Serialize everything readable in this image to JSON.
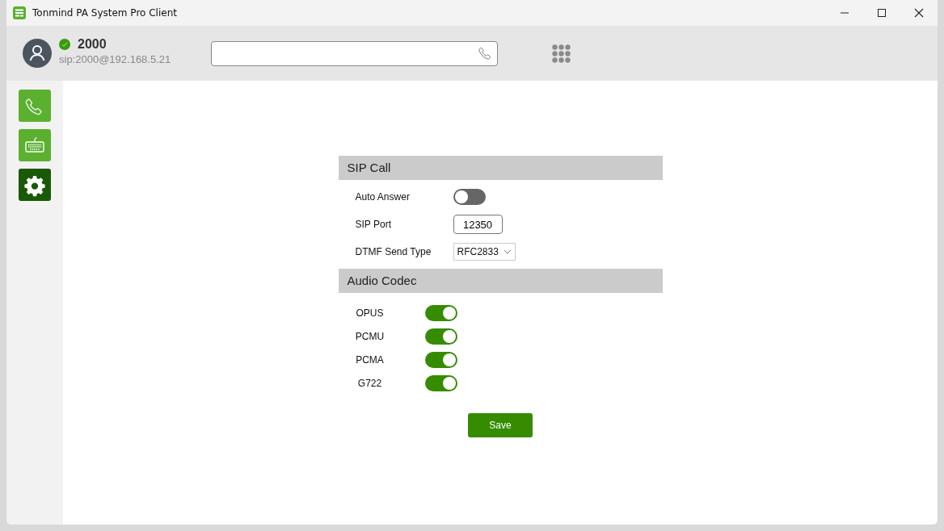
{
  "window": {
    "title": "Tonmind PA System Pro Client"
  },
  "account": {
    "number": "2000",
    "address": "sip:2000@192.168.5.21",
    "online": true
  },
  "sidebar": {
    "items": [
      {
        "kind": "phone",
        "selected": false
      },
      {
        "kind": "keyboard",
        "selected": false
      },
      {
        "kind": "settings",
        "selected": true
      }
    ]
  },
  "sections": [
    {
      "title": "SIP Call",
      "kind": "form",
      "rows": [
        {
          "kind": "toggle",
          "label": "Auto Answer",
          "on": false
        },
        {
          "kind": "input",
          "label": "SIP Port",
          "value": "12350"
        },
        {
          "kind": "select",
          "label": "DTMF Send Type",
          "value": "RFC2833"
        }
      ]
    },
    {
      "title": "Audio Codec",
      "kind": "codecs",
      "rows": [
        {
          "kind": "toggle",
          "label": "OPUS",
          "on": true
        },
        {
          "kind": "toggle",
          "label": "PCMU",
          "on": true
        },
        {
          "kind": "toggle",
          "label": "PCMA",
          "on": true
        },
        {
          "kind": "toggle",
          "label": "G722",
          "on": true
        }
      ]
    }
  ],
  "save_button": {
    "label": "Save"
  }
}
